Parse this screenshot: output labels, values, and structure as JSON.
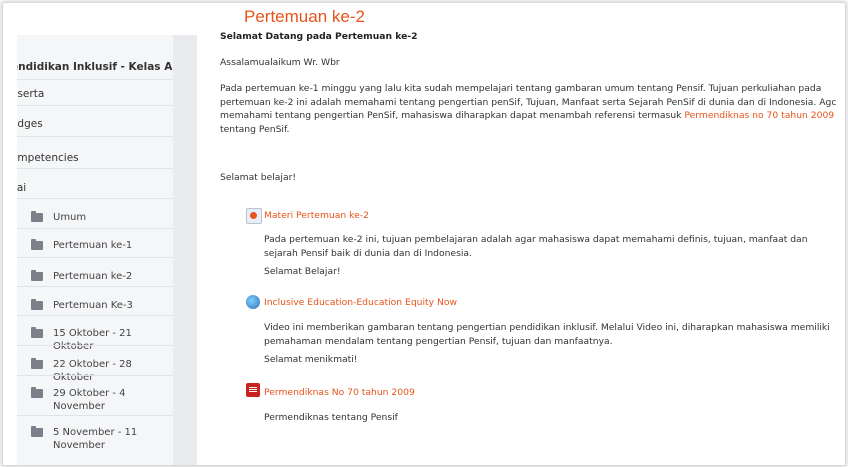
{
  "sidebar": {
    "course_title": "Pendidikan Inklusif - Kelas A",
    "course_title_visible": "endidikan Inklusif - Kelas A",
    "items": [
      {
        "label": "eserta"
      },
      {
        "label": "adges"
      },
      {
        "label": "ompetencies"
      },
      {
        "label": "ilai"
      }
    ],
    "sections": [
      {
        "label": "Umum"
      },
      {
        "label": "Pertemuan ke-1"
      },
      {
        "label": "Pertemuan ke-2"
      },
      {
        "label": "Pertemuan Ke-3"
      },
      {
        "label": "15 Oktober - 21 Oktober"
      },
      {
        "label": "22 Oktober - 28 Oktober"
      },
      {
        "label": "29 Oktober - 4 November"
      },
      {
        "label": "5 November - 11 November"
      }
    ]
  },
  "main": {
    "title": "Pertemuan ke-2",
    "welcome": "Selamat Datang pada Pertemuan ke-2",
    "greeting": "Assalamualaikum Wr. Wbr",
    "intro_part1": "Pada pertemuan ke-1 minggu yang lalu kita sudah mempelajari tentang gambaran umum tentang Pensif. Tujuan perkuliahan pada pertemuan ke-2 ini adalah memahami tentang pengertian penSif, Tujuan, Manfaat serta Sejarah PenSif di dunia dan di Indonesia. Agc memahami tentang pengertian PenSif, mahasiswa diharapkan dapat menambah referensi termasuk",
    "intro_link": "Permendiknas no 70 tahun 2009",
    "intro_part2": "tentang PenSif.",
    "closing": "Selamat belajar!",
    "activities": [
      {
        "icon": "page-icon",
        "title": "Materi Pertemuan ke-2",
        "desc": "Pada pertemuan ke-2 ini, tujuan pembelajaran adalah agar mahasiswa dapat memahami definis, tujuan, manfaat dan sejarah Pensif baik di dunia dan di Indonesia.",
        "note": "Selamat Belajar!"
      },
      {
        "icon": "globe-icon",
        "title": "Inclusive Education-Education Equity Now",
        "desc": "Video ini memberikan gambaran tentang pengertian pendidikan inklusif. Melalui Video ini, diharapkan mahasiswa memiliki pemahaman mendalam tentang pengertian Pensif, tujuan dan manfaatnya.",
        "note": "Selamat menikmati!"
      },
      {
        "icon": "pdf-icon",
        "title": "Permendiknas No 70 tahun 2009",
        "desc": "Permendiknas tentang Pensif",
        "note": ""
      }
    ]
  },
  "colors": {
    "accent": "#e8541b",
    "sidebar_bg": "#f5f6f8"
  }
}
